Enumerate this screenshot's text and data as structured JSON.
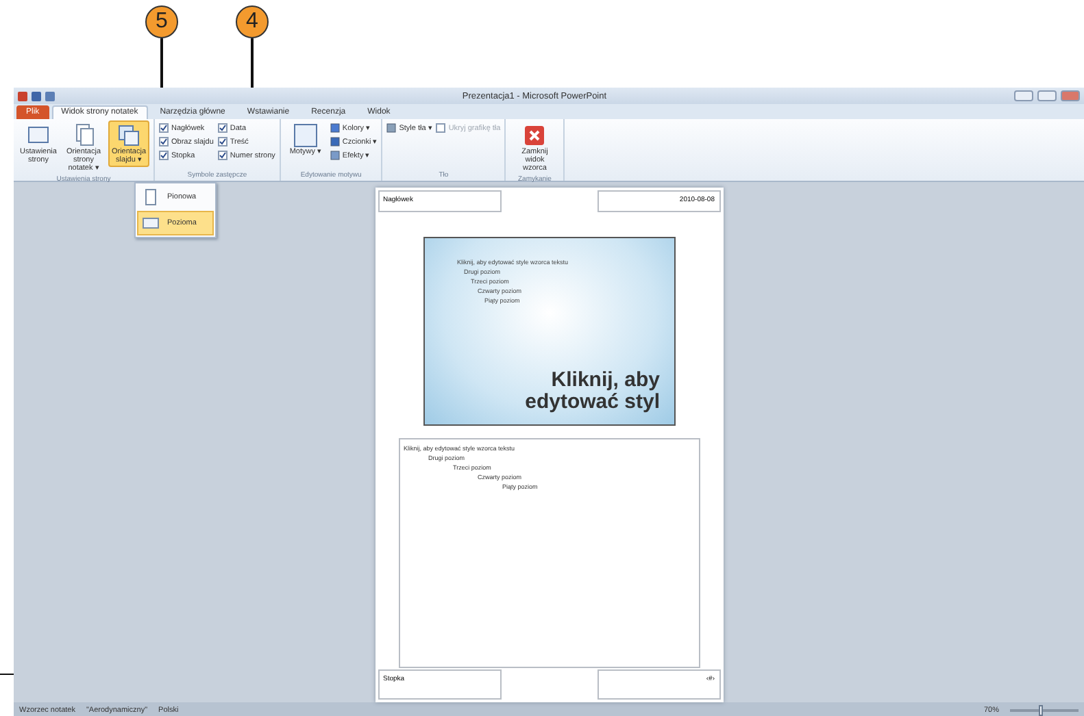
{
  "callouts": [
    "5",
    "4"
  ],
  "window": {
    "title": "Prezentacja1 - Microsoft PowerPoint"
  },
  "tabs": [
    {
      "label": "Plik",
      "kind": "file",
      "selected": false
    },
    {
      "label": "Widok strony notatek",
      "kind": "tab",
      "selected": true
    },
    {
      "label": "Narzędzia główne",
      "kind": "tab",
      "selected": false
    },
    {
      "label": "Wstawianie",
      "kind": "tab",
      "selected": false
    },
    {
      "label": "Recenzja",
      "kind": "tab",
      "selected": false
    },
    {
      "label": "Widok",
      "kind": "tab",
      "selected": false
    }
  ],
  "ribbon": {
    "groups": [
      {
        "label": "Ustawienia strony",
        "items": [
          {
            "kind": "large",
            "label": "Ustawienia strony",
            "selected": false
          },
          {
            "kind": "large",
            "label": "Orientacja strony notatek ▾",
            "selected": false
          },
          {
            "kind": "large",
            "label": "Orientacja slajdu ▾",
            "selected": true
          }
        ]
      },
      {
        "label": "Symbole zastępcze",
        "items": [
          {
            "kind": "checks",
            "checks": [
              {
                "label": "Nagłówek",
                "checked": true
              },
              {
                "label": "Obraz slajdu",
                "checked": true
              },
              {
                "label": "Stopka",
                "checked": true
              }
            ]
          },
          {
            "kind": "checks",
            "checks": [
              {
                "label": "Data",
                "checked": true
              },
              {
                "label": "Treść",
                "checked": true
              },
              {
                "label": "Numer strony",
                "checked": true
              }
            ]
          }
        ]
      },
      {
        "label": "Edytowanie motywu",
        "items": [
          {
            "kind": "large",
            "label": "Motywy ▾",
            "selected": false
          },
          {
            "kind": "small",
            "entries": [
              {
                "label": "Kolory ▾"
              },
              {
                "label": "Czcionki ▾"
              },
              {
                "label": "Efekty ▾"
              }
            ]
          }
        ]
      },
      {
        "label": "Tło",
        "items": [
          {
            "kind": "small",
            "entries": [
              {
                "label": "Style tła ▾"
              }
            ]
          },
          {
            "kind": "checks",
            "checks": [
              {
                "label": "Ukryj grafikę tła",
                "checked": false,
                "disabled": true
              }
            ]
          }
        ]
      },
      {
        "label": "Zamykanie",
        "items": [
          {
            "kind": "large",
            "label": "Zamknij widok wzorca",
            "selected": false
          }
        ]
      }
    ]
  },
  "dropdown": [
    {
      "label": "Pionowa",
      "selected": false
    },
    {
      "label": "Pozioma",
      "selected": true
    }
  ],
  "notes_page": {
    "header": "Nagłówek",
    "date": "2010-08-08",
    "slide": {
      "levels": [
        "Kliknij, aby edytować style wzorca tekstu",
        "Drugi poziom",
        "Trzeci poziom",
        "Czwarty poziom",
        "Piąty poziom"
      ],
      "title": "Kliknij, aby edytować styl"
    },
    "notes": [
      "Kliknij, aby edytować style wzorca tekstu",
      "Drugi poziom",
      "Trzeci poziom",
      "Czwarty poziom",
      "Piąty poziom"
    ],
    "footer": "Stopka",
    "page_number": "‹#›"
  },
  "status_bar": {
    "items": [
      "Wzorzec notatek",
      "\"Aerodynamiczny\"",
      "Polski"
    ],
    "zoom": "70%",
    "level": 0.45
  }
}
